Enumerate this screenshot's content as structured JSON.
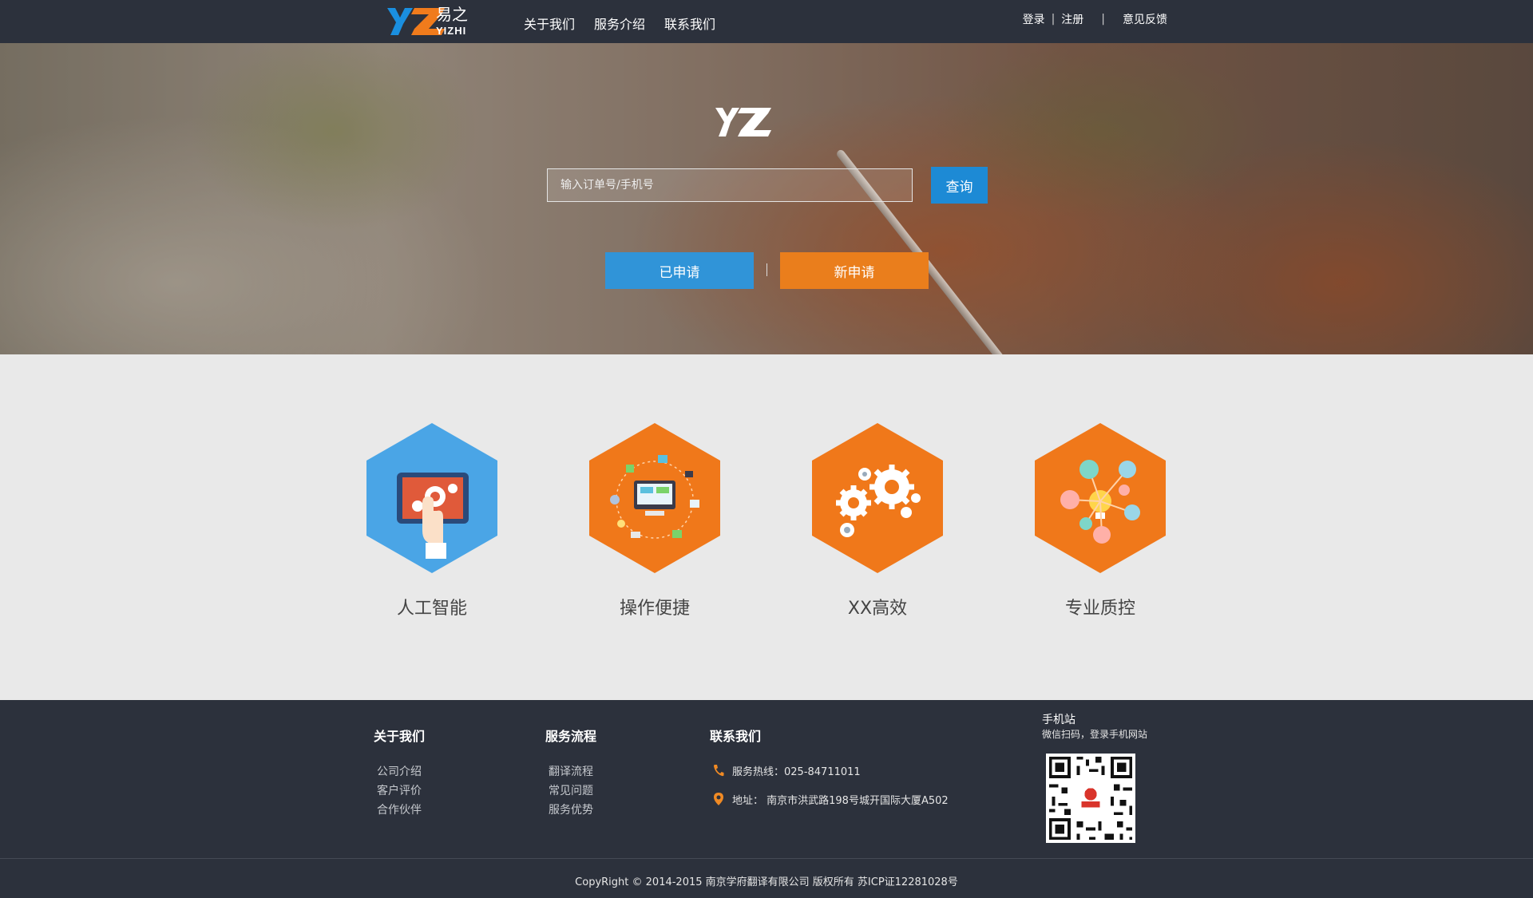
{
  "brand": {
    "name_cn": "易之",
    "name_en": "YIZHI",
    "colors": {
      "blue": "#1d8ad5",
      "orange": "#ea7e1c",
      "dark": "#2c313c"
    }
  },
  "nav": {
    "items": [
      {
        "label": "关于我们"
      },
      {
        "label": "服务介绍"
      },
      {
        "label": "联系我们"
      }
    ]
  },
  "top_links": {
    "login": "登录",
    "register": "注册",
    "feedback": "意见反馈"
  },
  "hero": {
    "search": {
      "placeholder": "输入订单号/手机号",
      "value": ""
    },
    "search_button": "查询",
    "applied_button": "已申请",
    "new_button": "新申请"
  },
  "features": [
    {
      "label": "人工智能",
      "icon": "tablet-gear-icon"
    },
    {
      "label": "操作便捷",
      "icon": "computer-network-icon"
    },
    {
      "label": "XX高效",
      "icon": "gears-icon"
    },
    {
      "label": "专业质控",
      "icon": "lightbulb-gears-icon"
    }
  ],
  "footer": {
    "about": {
      "title": "关于我们",
      "links": [
        "公司介绍",
        "客户评价",
        "合作伙伴"
      ]
    },
    "process": {
      "title": "服务流程",
      "links": [
        "翻译流程",
        "常见问题",
        "服务优势"
      ]
    },
    "contact": {
      "title": "联系我们",
      "hotline": "服务热线：025-84711011",
      "address": "地址： 南京市洪武路198号城开国际大厦A502"
    },
    "mobile": {
      "title": "手机站",
      "subtitle": "微信扫码，登录手机网站"
    },
    "copyright": "CopyRight © 2014-2015 南京学府翻译有限公司 版权所有 苏ICP证12281028号"
  }
}
